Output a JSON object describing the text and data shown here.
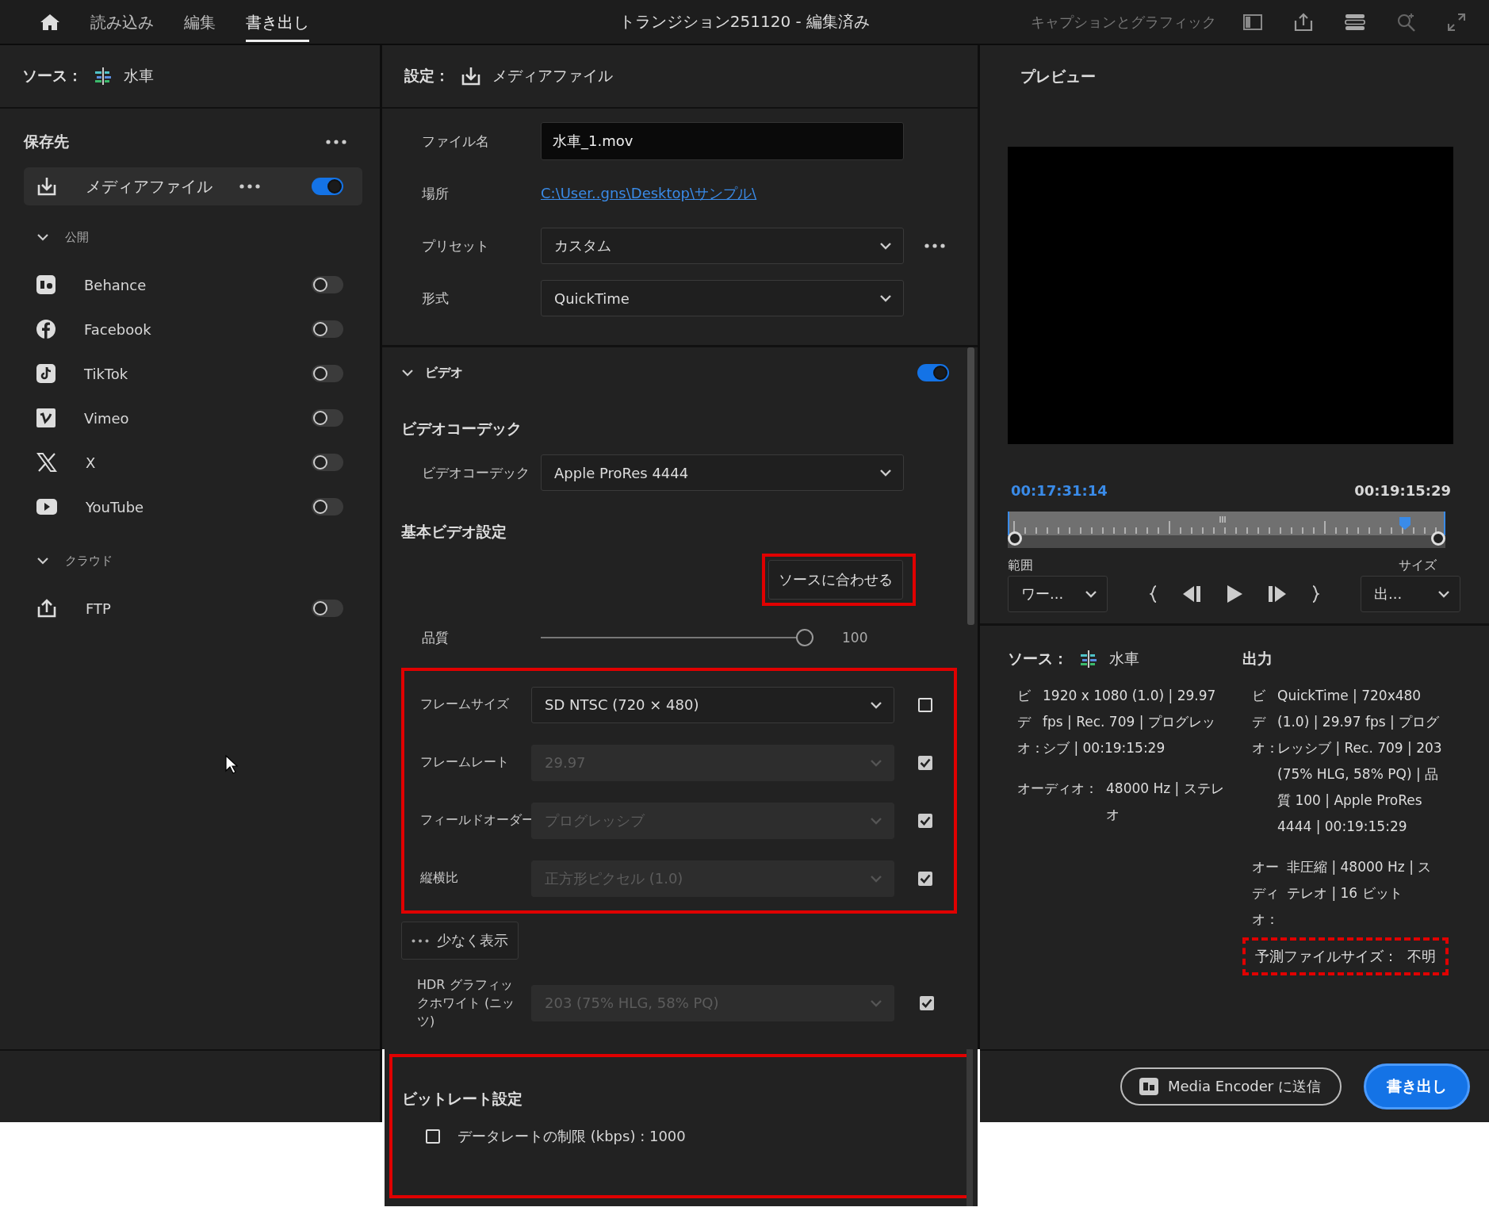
{
  "top_bar": {
    "tabs": [
      {
        "label": "読み込み",
        "selected": false
      },
      {
        "label": "編集",
        "selected": false
      },
      {
        "label": "書き出し",
        "selected": true
      }
    ],
    "title": "トランジション251120 - 編集済み",
    "workspace_label": "キャプションとグラフィック"
  },
  "source_panel": {
    "label": "ソース：",
    "name": "水車"
  },
  "destinations": {
    "title": "保存先",
    "media_file": {
      "label": "メディアファイル",
      "on": true
    },
    "groups": [
      {
        "label": "公開",
        "expanded": true,
        "items": [
          {
            "label": "Behance",
            "kind": "behance",
            "on": false
          },
          {
            "label": "Facebook",
            "kind": "facebook",
            "on": false
          },
          {
            "label": "TikTok",
            "kind": "tiktok",
            "on": false
          },
          {
            "label": "Vimeo",
            "kind": "vimeo",
            "on": false
          },
          {
            "label": "X",
            "kind": "x",
            "on": false
          },
          {
            "label": "YouTube",
            "kind": "youtube",
            "on": false
          }
        ]
      },
      {
        "label": "クラウド",
        "expanded": true,
        "items": [
          {
            "label": "FTP",
            "kind": "ftp",
            "on": false
          }
        ]
      }
    ]
  },
  "settings": {
    "label": "設定：",
    "target": "メディアファイル",
    "fields": [
      {
        "label": "ファイル名",
        "kind": "input",
        "value": "水車_1.mov"
      },
      {
        "label": "場所",
        "kind": "link",
        "value": "C:\\User..gns\\Desktop\\サンプル\\"
      },
      {
        "label": "プリセット",
        "kind": "select",
        "value": "カスタム",
        "more": true
      },
      {
        "label": "形式",
        "kind": "select",
        "value": "QuickTime"
      }
    ]
  },
  "video": {
    "title": "ビデオ",
    "expanded": true,
    "on": true,
    "codec_heading": "ビデオコーデック",
    "codec": {
      "label": "ビデオコーデック",
      "value": "Apple ProRes 4444"
    },
    "basic_heading": "基本ビデオ設定",
    "match_button": {
      "label": "ソースに合わせる",
      "highlighted": true
    },
    "quality": {
      "label": "品質",
      "level": 1.0,
      "reading": "100"
    },
    "frame_settings": {
      "highlighted": true,
      "rows": [
        {
          "label": "フレームサイズ",
          "value": "SD NTSC (720 × 480)",
          "disabled": false,
          "checked": false
        },
        {
          "label": "フレームレート",
          "value": "29.97",
          "disabled": true,
          "checked": true
        },
        {
          "label": "フィールドオーダー",
          "value": "プログレッシブ",
          "disabled": true,
          "checked": true
        },
        {
          "label": "縦横比",
          "value": "正方形ピクセル (1.0)",
          "disabled": true,
          "checked": true
        }
      ]
    },
    "fewer_button": "少なく表示",
    "hdr": {
      "label": "HDR グラフィックホワイト (ニッツ)",
      "value": "203 (75% HLG, 58% PQ)",
      "disabled": true,
      "checked": true
    }
  },
  "bitrate": {
    "title": "ビットレート設定",
    "highlighted": true,
    "limit": {
      "label": "データレートの制限 (kbps) : 1000",
      "checked": false
    }
  },
  "preview": {
    "title": "プレビュー",
    "current_time": "00:17:31:14",
    "duration": "00:19:15:29",
    "scrubber": {
      "level": 0.91
    },
    "range_label": "範囲",
    "range_value": "ワー...",
    "size_label": "サイズ",
    "size_value": "出..."
  },
  "summary": {
    "source": {
      "label": "ソース：",
      "name": "水車",
      "rows": [
        {
          "label": "ビデオ：",
          "value": "1920 x 1080 (1.0) | 29.97 fps | Rec. 709 | プログレッシブ | 00:19:15:29"
        },
        {
          "label": "オーディオ：",
          "value": "48000 Hz | ステレオ"
        }
      ]
    },
    "output": {
      "title": "出力",
      "rows": [
        {
          "label": "ビデオ：",
          "value": "QuickTime | 720x480 (1.0) | 29.97 fps | プログレッシブ | Rec. 709 | 203 (75% HLG, 58% PQ) | 品質 100 | Apple ProRes 4444 | 00:19:15:29"
        },
        {
          "label": "オーディオ：",
          "value": "非圧縮 | 48000 Hz | ステレオ | 16 ビット"
        }
      ]
    },
    "estimate": {
      "label": "予測ファイルサイズ：",
      "value": "不明",
      "highlighted": true
    }
  },
  "footer": {
    "send_button": "Media Encoder に送信",
    "export_button": "書き出し"
  }
}
